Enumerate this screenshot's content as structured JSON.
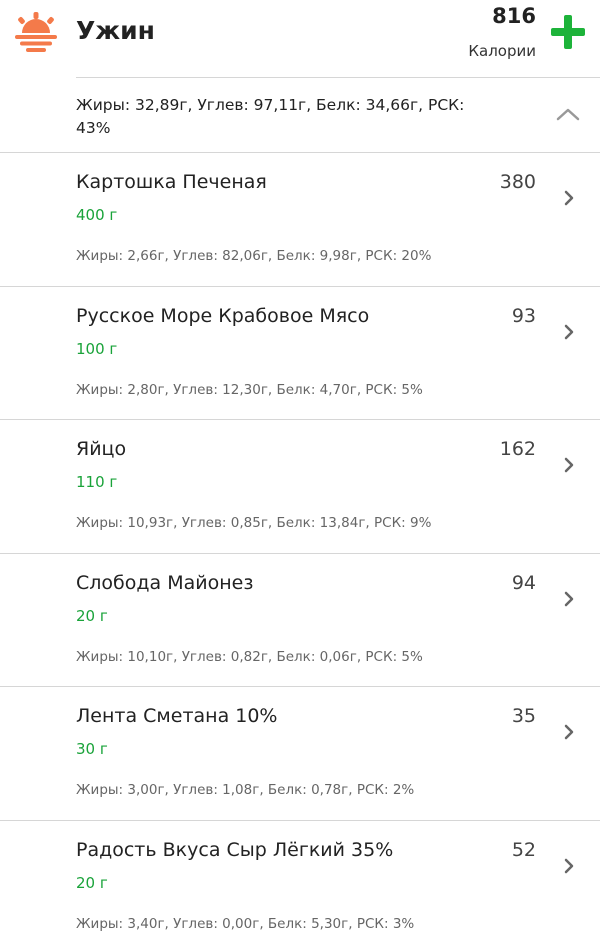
{
  "header": {
    "title": "Ужин",
    "total_calories": "816",
    "calories_label": "Калории",
    "icon": "sunset-icon",
    "add_icon": "plus-icon",
    "accent_color": "#1db33a",
    "icon_color": "#f47a4a"
  },
  "summary": {
    "text": "Жиры: 32,89г, Углев: 97,11г, Белк: 34,66г, РСК: 43%",
    "collapse_icon": "chevron-up-icon"
  },
  "items": [
    {
      "name": "Картошка Печеная",
      "amount": "400 г",
      "calories": "380",
      "macros": "Жиры: 2,66г, Углев: 82,06г, Белк: 9,98г, РСК: 20%"
    },
    {
      "name": "Русское Море Крабовое Мясо",
      "amount": "100 г",
      "calories": "93",
      "macros": "Жиры: 2,80г, Углев: 12,30г, Белк: 4,70г, РСК: 5%"
    },
    {
      "name": "Яйцо",
      "amount": "110 г",
      "calories": "162",
      "macros": "Жиры: 10,93г, Углев: 0,85г, Белк: 13,84г, РСК: 9%"
    },
    {
      "name": "Слобода Майонез",
      "amount": "20 г",
      "calories": "94",
      "macros": "Жиры: 10,10г, Углев: 0,82г, Белк: 0,06г, РСК: 5%"
    },
    {
      "name": "Лента Сметана 10%",
      "amount": "30 г",
      "calories": "35",
      "macros": "Жиры: 3,00г, Углев: 1,08г, Белк: 0,78г, РСК: 2%"
    },
    {
      "name": "Радость Вкуса Сыр Лёгкий 35%",
      "amount": "20 г",
      "calories": "52",
      "macros": "Жиры: 3,40г, Углев: 0,00г, Белк: 5,30г, РСК: 3%"
    }
  ]
}
